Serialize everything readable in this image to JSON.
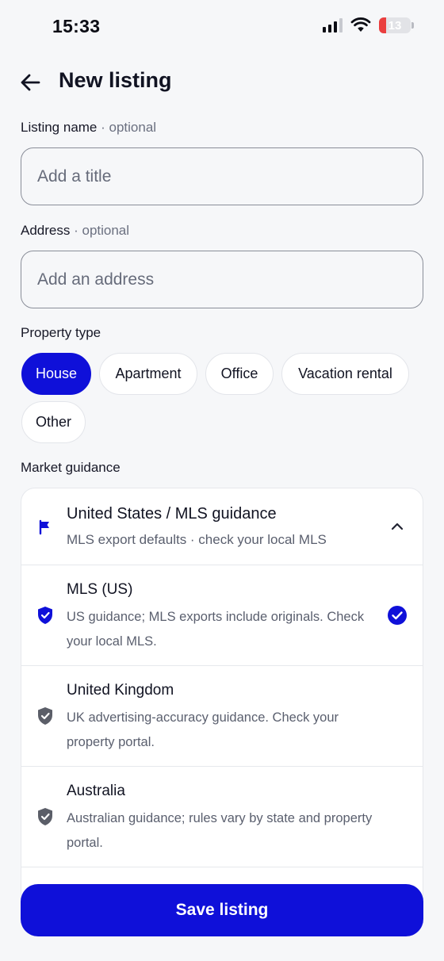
{
  "status_bar": {
    "time": "15:33",
    "battery": "13"
  },
  "header": {
    "title": "New listing"
  },
  "listing_name": {
    "label": "Listing name",
    "optional": "· optional",
    "placeholder": "Add a title"
  },
  "address": {
    "label": "Address",
    "optional": "· optional",
    "placeholder": "Add an address"
  },
  "property_type": {
    "label": "Property type",
    "options": [
      "House",
      "Apartment",
      "Office",
      "Vacation rental",
      "Other"
    ],
    "selected": "House"
  },
  "market_guidance": {
    "label": "Market guidance",
    "header_title": "United States / MLS guidance",
    "header_subtitle": "MLS export defaults · check your local MLS",
    "options": [
      {
        "title": "MLS (US)",
        "description": "US guidance; MLS exports include originals. Check your local MLS.",
        "selected": true
      },
      {
        "title": "United Kingdom",
        "description": "UK advertising-accuracy guidance. Check your property portal.",
        "selected": false
      },
      {
        "title": "Australia",
        "description": "Australian guidance; rules vary by state and property portal.",
        "selected": false
      }
    ]
  },
  "save_label": "Save listing",
  "colors": {
    "accent": "#0f10d9",
    "background": "#f6f7f9",
    "muted_text": "#5a5f6e",
    "battery_low": "#ea3f3f"
  },
  "icons": [
    "back-arrow-icon",
    "signal-icon",
    "wifi-icon",
    "battery-icon",
    "flag-icon",
    "chevron-up-icon",
    "shield-check-icon",
    "check-circle-icon"
  ]
}
